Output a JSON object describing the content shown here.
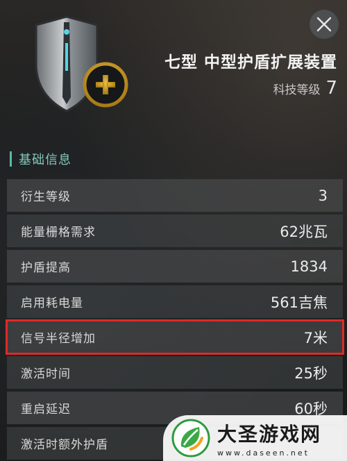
{
  "item": {
    "name": "七型 中型护盾扩展装置",
    "tech_label": "科技等级",
    "tech_level": "7"
  },
  "icons": {
    "item": "shield-icon",
    "badge": "plus-icon",
    "close": "close-icon",
    "watermark": "leaf-logo-icon"
  },
  "section": {
    "title": "基础信息"
  },
  "stats": [
    {
      "label": "衍生等级",
      "value": "3"
    },
    {
      "label": "能量栅格需求",
      "value": "62兆瓦"
    },
    {
      "label": "护盾提高",
      "value": "1834"
    },
    {
      "label": "启用耗电量",
      "value": "561吉焦"
    },
    {
      "label": "信号半径增加",
      "value": "7米"
    },
    {
      "label": "激活时间",
      "value": "25秒"
    },
    {
      "label": "重启延迟",
      "value": "60秒"
    },
    {
      "label": "激活时额外护盾",
      "value": ""
    }
  ],
  "watermark": {
    "title": "大圣游戏网",
    "url": "www.daseen.net"
  },
  "colors": {
    "accent": "#5fb8a7",
    "highlight": "#e02a26",
    "badge_gold": "#e2b23a"
  }
}
